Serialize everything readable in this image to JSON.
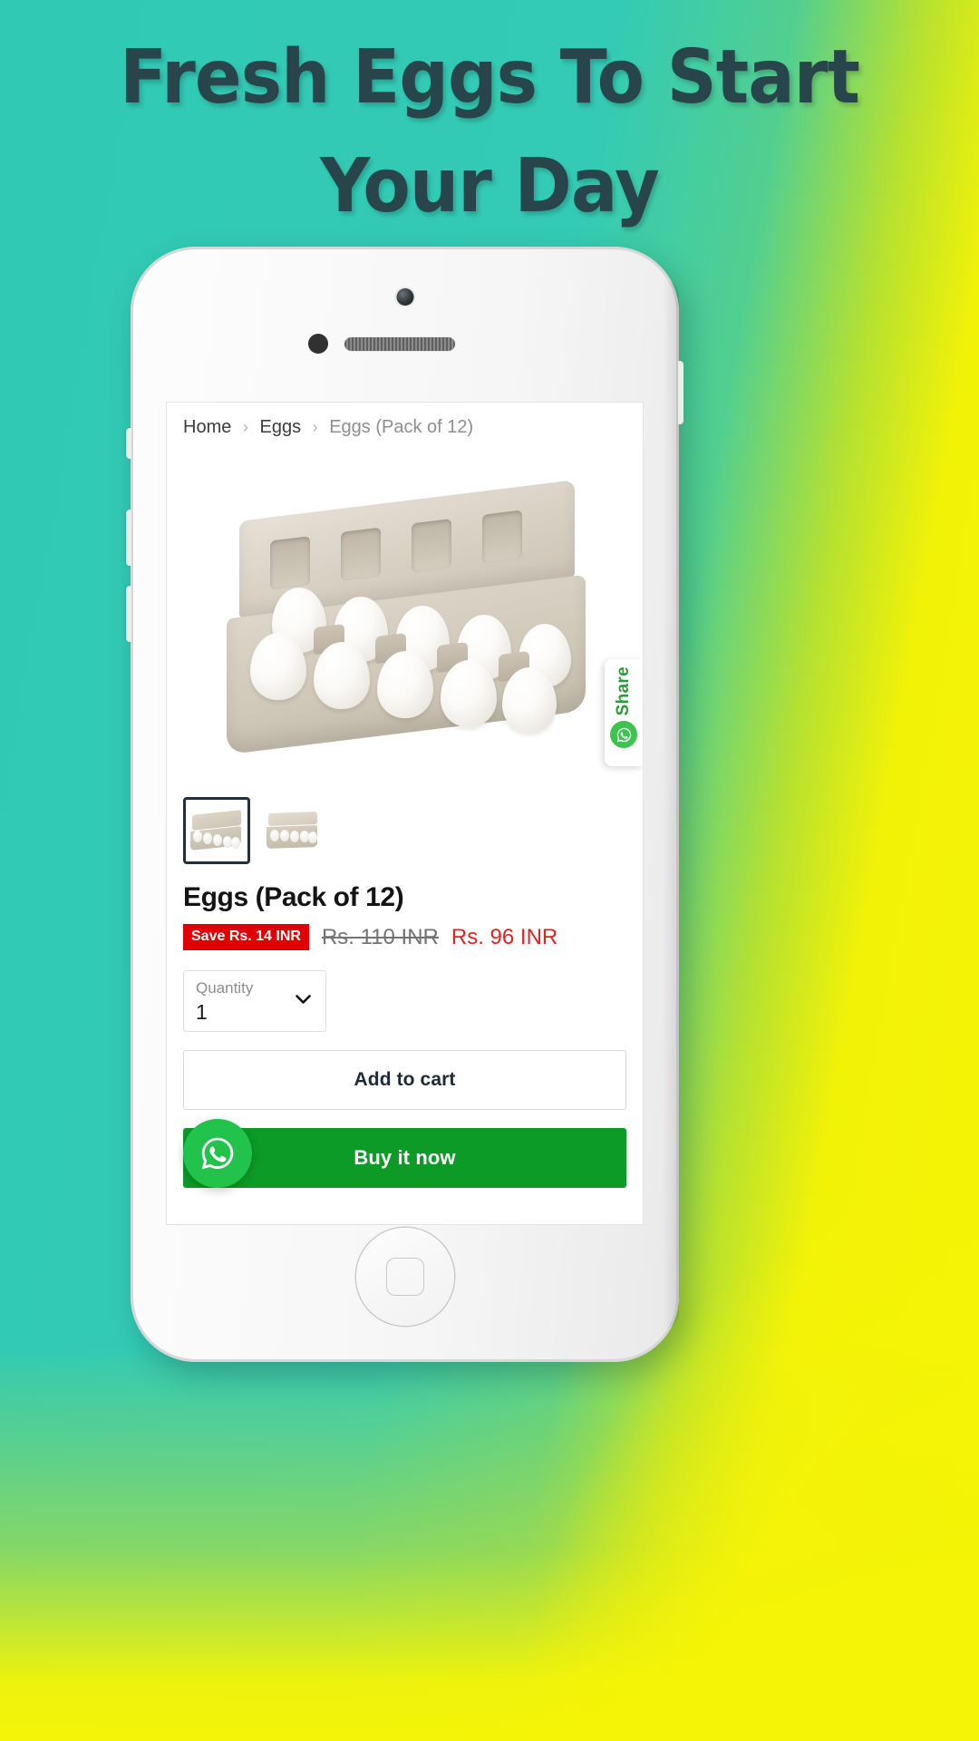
{
  "banner": {
    "headline": "Fresh Eggs To Start Your Day",
    "headline_color": "#27454a",
    "bg_teal": "#30c9b4",
    "bg_yellow": "#f6f406"
  },
  "screen": {
    "breadcrumb": {
      "home": "Home",
      "category": "Eggs",
      "separator": "›",
      "current": "Eggs (Pack of 12)"
    },
    "share_tab": {
      "label": "Share",
      "icon": "whatsapp-icon",
      "color": "#2a9d34"
    },
    "gallery": {
      "main_alt": "egg-carton-image",
      "thumbnails": [
        {
          "alt": "egg-carton-thumb-1",
          "selected": true
        },
        {
          "alt": "egg-carton-thumb-2",
          "selected": false
        }
      ]
    },
    "product": {
      "title": "Eggs (Pack of 12)",
      "save_badge": "Save Rs. 14 INR",
      "price_compare": "Rs. 110 INR",
      "price_sale": "Rs. 96 INR",
      "badge_color": "#e00000",
      "sale_color": "#e02222"
    },
    "quantity": {
      "label": "Quantity",
      "value": "1",
      "icon": "chevron-down-icon"
    },
    "actions": {
      "add_to_cart": "Add to cart",
      "buy_it_now": "Buy it now",
      "buy_color": "#0c9b27"
    },
    "whatsapp_float": {
      "icon": "whatsapp-icon",
      "color": "#22c34b"
    }
  }
}
